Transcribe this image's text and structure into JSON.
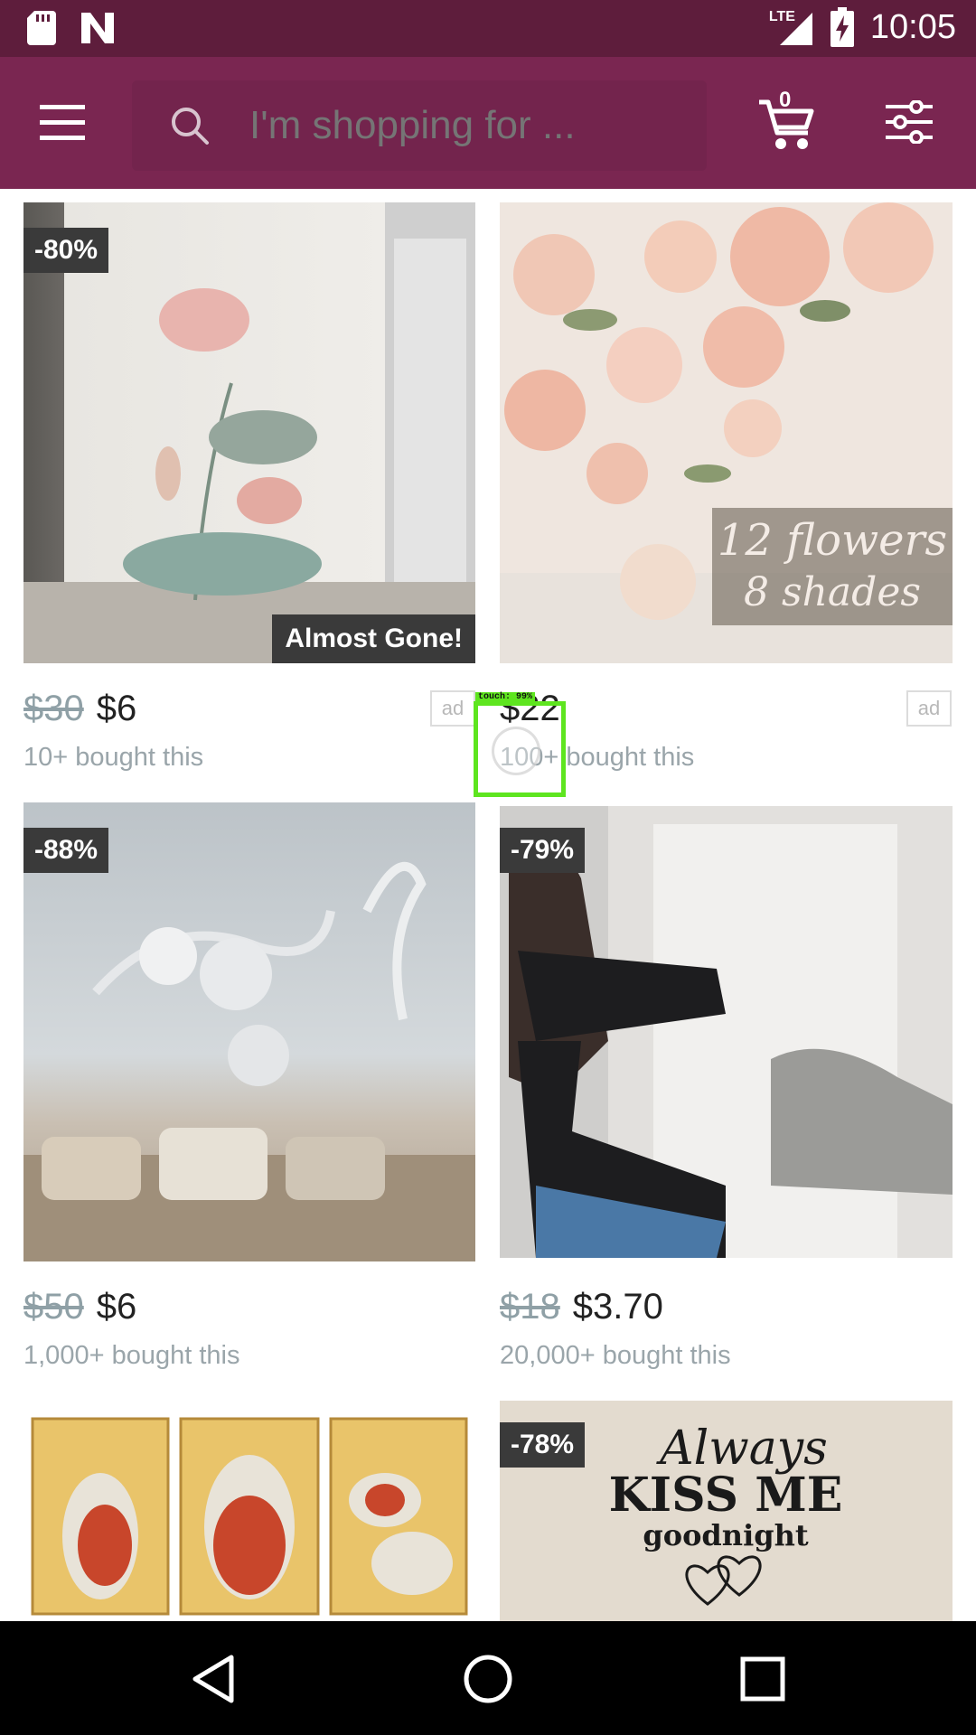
{
  "status_bar": {
    "time": "10:05",
    "network": "LTE"
  },
  "search": {
    "placeholder": "I'm shopping for ...",
    "cart_count": "0"
  },
  "products": [
    {
      "discount": "-80%",
      "overlay": "Almost Gone!",
      "old_price": "$30",
      "price": "$6",
      "bought": "10+ bought this",
      "ad": "ad"
    },
    {
      "discount": "",
      "overlay": "12 flowers\n8 shades",
      "old_price": "",
      "price": "$22",
      "bought": "100+ bought this",
      "ad": "ad"
    },
    {
      "discount": "-88%",
      "old_price": "$50",
      "price": "$6",
      "bought": "1,000+ bought this"
    },
    {
      "discount": "-79%",
      "old_price": "$18",
      "price": "$3.70",
      "bought": "20,000+ bought this"
    },
    {
      "discount": ""
    },
    {
      "discount": "-78%",
      "image_text": [
        "Always",
        "KISS ME",
        "goodnight"
      ]
    }
  ],
  "touch": {
    "label": "touch: 99%"
  },
  "colors": {
    "status_bar": "#5e1d3c",
    "app_bar": "#7a2651",
    "badge": "#3a3a3a",
    "touch": "#5ee51f"
  }
}
